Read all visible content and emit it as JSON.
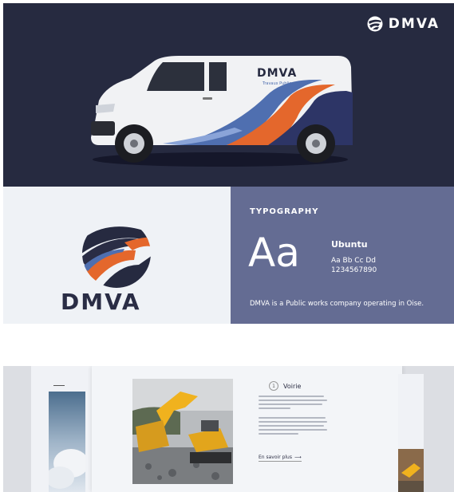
{
  "hero": {
    "brand": "DMVA",
    "van_brand": "DMVA",
    "van_tagline": "Travaux Publics"
  },
  "logo_panel": {
    "wordmark": "DMVA"
  },
  "typography": {
    "heading": "TYPOGRAPHY",
    "sample": "Aa",
    "font_name": "Ubuntu",
    "alphabet": "Aa Bb Cc Dd",
    "digits": "1234567890",
    "description": "DMVA is a Public works company operating in Oise."
  },
  "website": {
    "section_number": "1",
    "section_title": "Voirie",
    "more_link": "En savoir plus"
  },
  "colors": {
    "navy": "#262a40",
    "slate": "#646c93",
    "orange": "#e4672c",
    "light": "#eff2f6",
    "blue_stripe": "#4f6fb0"
  }
}
